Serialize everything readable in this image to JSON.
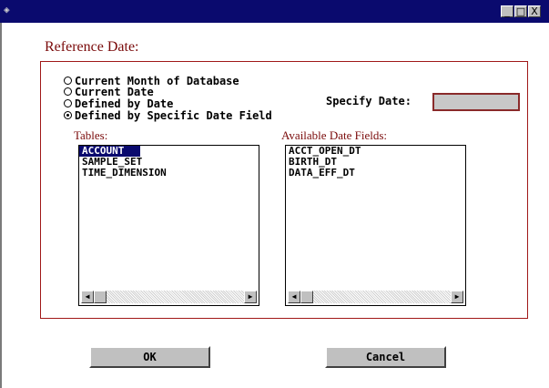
{
  "window": {
    "controls": {
      "minimize": "_",
      "maximize": "□",
      "close": "X"
    }
  },
  "section": {
    "heading": "Reference Date:"
  },
  "options": [
    {
      "label": "Current Month of Database",
      "selected": false
    },
    {
      "label": "Current Date",
      "selected": false
    },
    {
      "label": "Defined by Date",
      "selected": false
    },
    {
      "label": "Defined by Specific Date Field",
      "selected": true
    }
  ],
  "specify_date": {
    "label": "Specify Date:",
    "value": ""
  },
  "tables": {
    "caption": "Tables:",
    "items": [
      "ACCOUNT",
      "SAMPLE_SET",
      "TIME_DIMENSION"
    ],
    "selected": "ACCOUNT"
  },
  "fields": {
    "caption": "Available Date Fields:",
    "items": [
      "ACCT_OPEN_DT",
      "BIRTH_DT",
      "DATA_EFF_DT"
    ]
  },
  "buttons": {
    "ok": "OK",
    "cancel": "Cancel"
  }
}
